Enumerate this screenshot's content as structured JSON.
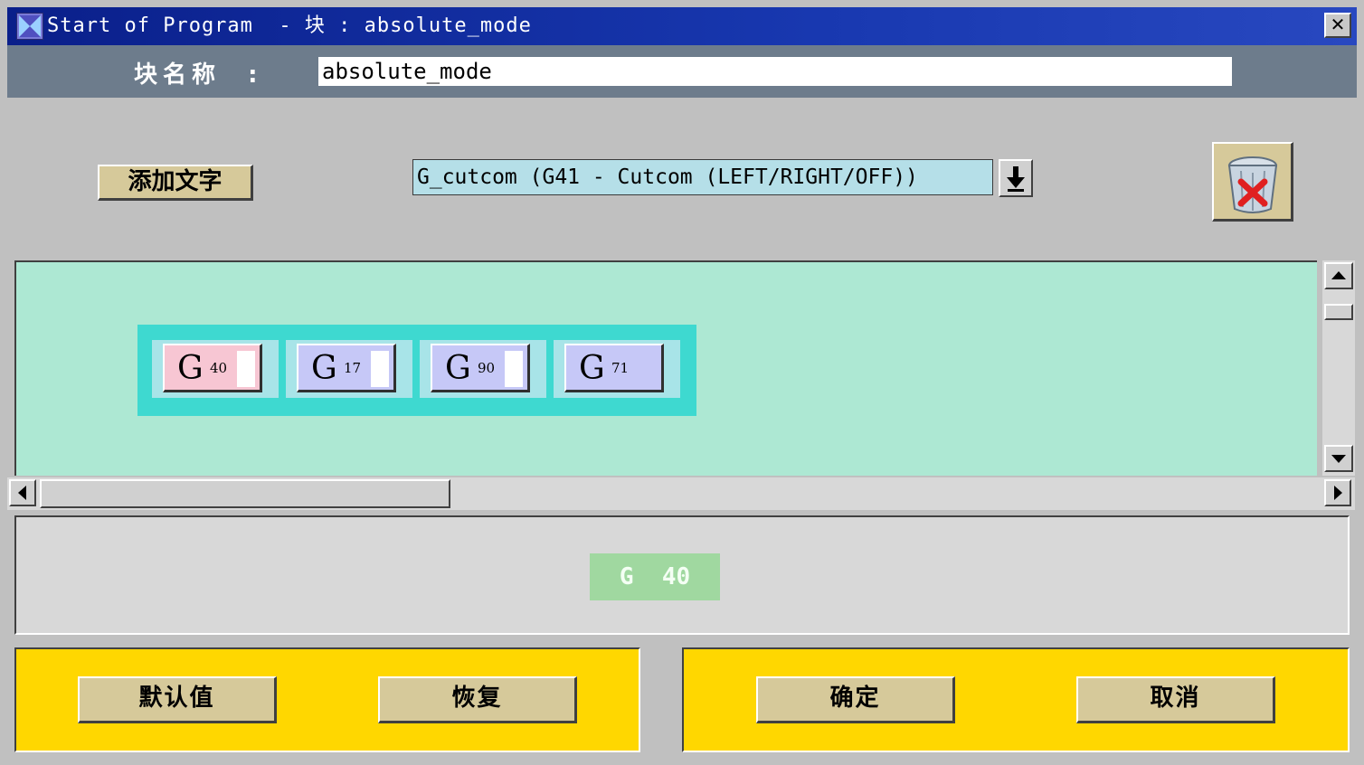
{
  "window": {
    "title": "Start of Program  - 块 : absolute_mode",
    "close_label": "✕"
  },
  "name_row": {
    "label": "块名称  :",
    "value": "absolute_mode"
  },
  "toolbar": {
    "add_text_label": "添加文字",
    "combo_value": "G_cutcom (G41 - Cutcom (LEFT/RIGHT/OFF))",
    "trash_icon": "trash-delete-icon"
  },
  "codes": [
    {
      "letter": "G",
      "number": "40",
      "color": "#f7c6d3",
      "selected": true
    },
    {
      "letter": "G",
      "number": "17",
      "color": "#c6c8f7",
      "selected": false
    },
    {
      "letter": "G",
      "number": "90",
      "color": "#c6c8f7",
      "selected": false
    },
    {
      "letter": "G",
      "number": "71",
      "color": "#c6c8f7",
      "selected": false
    }
  ],
  "preview": {
    "text": "G  40"
  },
  "buttons": {
    "default_label": "默认值",
    "restore_label": "恢复",
    "ok_label": "确定",
    "cancel_label": "取消"
  },
  "colors": {
    "title_bar": "#0a1f8a",
    "canvas_bg": "#ade8d3",
    "group_bg": "#3ed9d0",
    "panel_bg": "#ffd700"
  }
}
